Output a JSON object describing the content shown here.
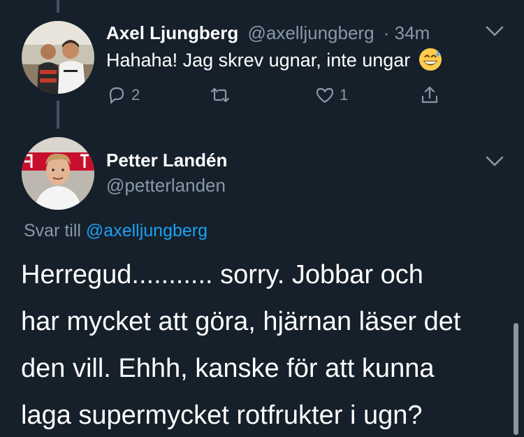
{
  "tweets": [
    {
      "name": "Axel Ljungberg",
      "handle": "@axelljungberg",
      "time": "· 34m",
      "text": "Hahaha! Jag skrev ugnar, inte ungar",
      "emoji": "grinning-sweat-emoji",
      "actions": {
        "replies": "2",
        "retweets": "",
        "likes": "1"
      }
    },
    {
      "name": "Petter Landén",
      "handle": "@petterlanden",
      "reply_prefix": "Svar till",
      "reply_to": "@axelljungberg",
      "text_lines": [
        "Herregud........... sorry. Jobbar och",
        "har mycket att göra, hjärnan läser det",
        "den vill. Ehhh, kanske för att kunna",
        "laga supermycket rotfrukter i ugn?"
      ]
    }
  ],
  "icons": {
    "reply": "speech-bubble-icon",
    "retweet": "retweet-icon",
    "like": "heart-icon",
    "share": "share-icon",
    "menu": "chevron-down-icon"
  },
  "colors": {
    "background": "#15202b",
    "secondary_text": "#8899a6",
    "link": "#1da1f2",
    "thread_line": "#3d5466"
  }
}
